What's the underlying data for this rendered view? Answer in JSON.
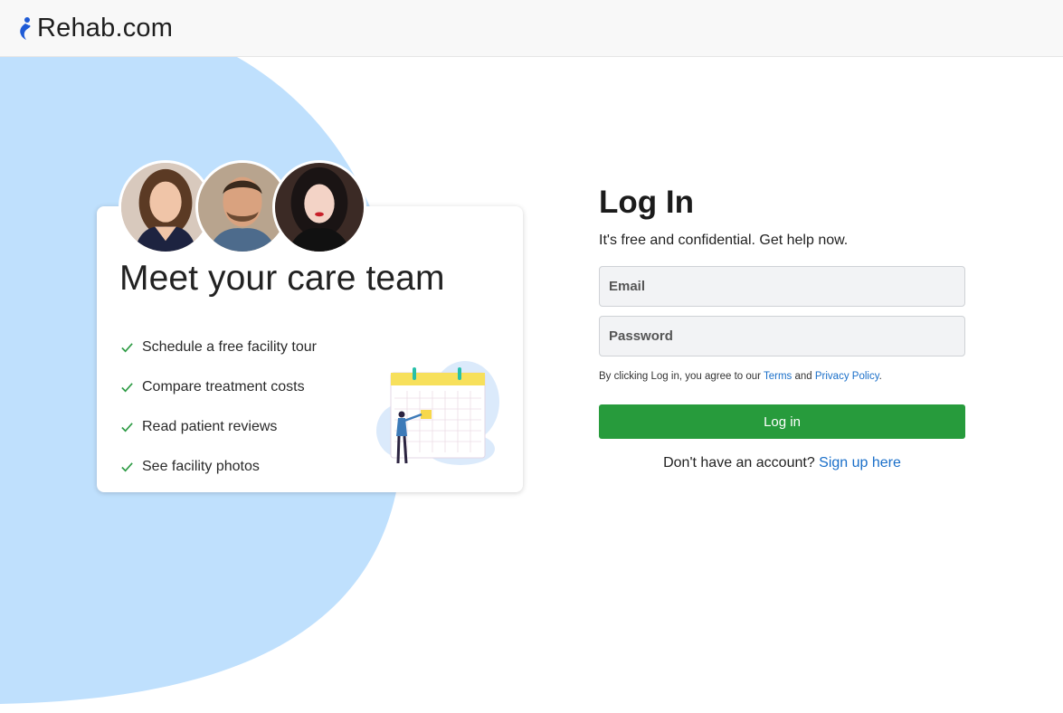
{
  "header": {
    "logo_text": "Rehab.com",
    "logo_icon": "rehab-person-icon"
  },
  "promo": {
    "title": "Meet your care team",
    "features": [
      "Schedule a free facility tour",
      "Compare treatment costs",
      "Read patient reviews",
      "See facility photos"
    ],
    "check_icon": "check-icon",
    "illustration": "calendar-illustration"
  },
  "login": {
    "title": "Log In",
    "subtitle": "It's free and confidential. Get help now.",
    "email_placeholder": "Email",
    "password_placeholder": "Password",
    "legal_prefix": "By clicking Log in, you agree to our ",
    "terms_label": "Terms",
    "legal_and": " and ",
    "privacy_label": "Privacy Policy",
    "legal_suffix": ".",
    "button_label": "Log in",
    "signup_prompt": "Don't have an account? ",
    "signup_link": "Sign up here"
  },
  "colors": {
    "accent_blue": "#1a6fc9",
    "button_green": "#279b3c",
    "bg_blue": "#bfe0fd",
    "check_green": "#2e9b45"
  }
}
